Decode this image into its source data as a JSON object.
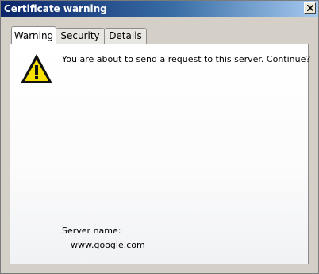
{
  "window": {
    "title": "Certificate warning"
  },
  "tabs": [
    {
      "label": "Warning",
      "active": true
    },
    {
      "label": "Security",
      "active": false
    },
    {
      "label": "Details",
      "active": false
    }
  ],
  "panel": {
    "icon": "warning-icon",
    "message": "You are about to send a request to this server. Continue?",
    "server_name_label": "Server name:",
    "server_name_value": "www.google.com"
  },
  "colors": {
    "title_bar_start": "#0a246a",
    "title_bar_end": "#a6caf0",
    "warning_yellow": "#f7e000"
  }
}
